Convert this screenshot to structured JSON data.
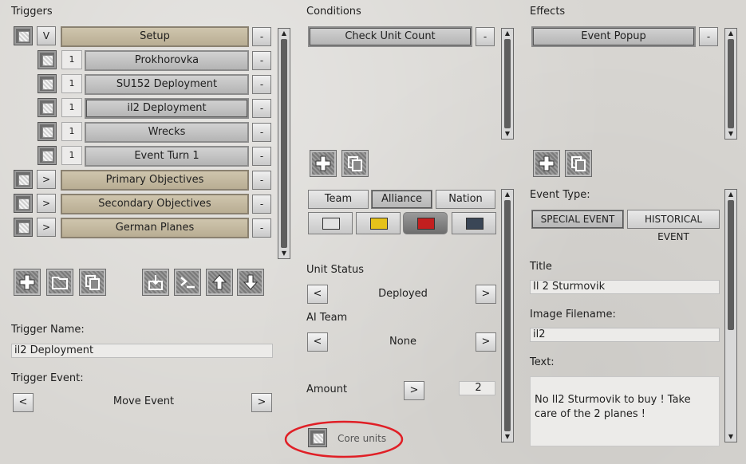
{
  "triggers": {
    "heading": "Triggers",
    "items": [
      {
        "expander": "V",
        "name": "Setup",
        "count": "",
        "remove": "-"
      },
      {
        "expander": "",
        "name": "Prokhorovka",
        "count": "1",
        "remove": "-"
      },
      {
        "expander": "",
        "name": "SU152 Deployment",
        "count": "1",
        "remove": "-"
      },
      {
        "expander": "",
        "name": "il2 Deployment",
        "count": "1",
        "remove": "-"
      },
      {
        "expander": "",
        "name": "Wrecks",
        "count": "1",
        "remove": "-"
      },
      {
        "expander": "",
        "name": "Event Turn 1",
        "count": "1",
        "remove": "-"
      },
      {
        "expander": ">",
        "name": "Primary Objectives",
        "count": "",
        "remove": "-"
      },
      {
        "expander": ">",
        "name": "Secondary Objectives",
        "count": "",
        "remove": "-"
      },
      {
        "expander": ">",
        "name": "German Planes",
        "count": "",
        "remove": "-"
      }
    ],
    "name_label": "Trigger Name:",
    "name_value": "il2 Deployment",
    "event_label": "Trigger Event:",
    "event_value": "Move Event",
    "prev": "<",
    "next": ">"
  },
  "conditions": {
    "heading": "Conditions",
    "items": [
      {
        "name": "Check Unit Count",
        "remove": "-"
      }
    ],
    "tabs": [
      "Team",
      "Alliance",
      "Nation"
    ],
    "active_tab": "Alliance",
    "swatches": [
      "#e2e2e2",
      "#e6c21a",
      "#c31f1f",
      "#3a4656"
    ],
    "active_swatch": 2,
    "unit_status_label": "Unit Status",
    "unit_status_value": "Deployed",
    "ai_team_label": "AI Team",
    "ai_team_value": "None",
    "amount_label": "Amount",
    "amount_value": "2",
    "core_units_label": "Core units",
    "prev": "<",
    "next": ">"
  },
  "effects": {
    "heading": "Effects",
    "items": [
      {
        "name": "Event Popup",
        "remove": "-"
      }
    ],
    "event_type_label": "Event Type:",
    "event_types": [
      "SPECIAL EVENT",
      "HISTORICAL EVENT"
    ],
    "active_event_type": "SPECIAL EVENT",
    "title_label": "Title",
    "title_value": "Il 2 Sturmovik",
    "image_label": "Image Filename:",
    "image_value": "il2",
    "text_label": "Text:",
    "text_value": "No Il2 Sturmovik to buy ! Take care of the 2 planes !"
  },
  "icons": {
    "add": "plus-icon",
    "folder": "folder-icon",
    "copy": "copy-icon",
    "import": "import-icon",
    "console": "console-icon",
    "up": "arrow-up-icon",
    "down": "arrow-down-icon"
  },
  "colors": {
    "highlight": "#e01f26",
    "group_button": "#c4b9a0"
  }
}
